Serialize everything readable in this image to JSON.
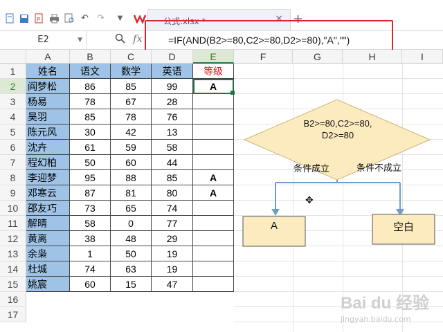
{
  "toolbar": {
    "tab_title": "公式.xlsx *",
    "tab_close": "×",
    "tab_add": "+",
    "icons": [
      "new-file-icon",
      "save-icon",
      "export-pdf-icon",
      "print-icon",
      "print-preview-icon",
      "undo-icon",
      "redo-icon",
      "dropdown-icon",
      "wps-logo-icon"
    ]
  },
  "formula_bar": {
    "cell_ref": "E2",
    "formula": "=IF(AND(B2>=80,C2>=80,D2>=80),\"A\",\"\")",
    "fx": "fx"
  },
  "columns": [
    "A",
    "B",
    "C",
    "D",
    "E",
    "F",
    "G",
    "H",
    "I"
  ],
  "rows": [
    "1",
    "2",
    "3",
    "4",
    "5",
    "6",
    "7",
    "8",
    "9",
    "10",
    "11",
    "12",
    "13",
    "14",
    "15",
    "16",
    "17"
  ],
  "table": {
    "headers": [
      "姓名",
      "语文",
      "数学",
      "英语",
      "等级"
    ],
    "data": [
      [
        "阎梦松",
        "86",
        "85",
        "99",
        "A"
      ],
      [
        "杨易",
        "78",
        "67",
        "28",
        ""
      ],
      [
        "吴羽",
        "85",
        "78",
        "76",
        ""
      ],
      [
        "陈元风",
        "30",
        "42",
        "13",
        ""
      ],
      [
        "沈卉",
        "61",
        "59",
        "58",
        ""
      ],
      [
        "程幻柏",
        "50",
        "60",
        "44",
        ""
      ],
      [
        "李迎梦",
        "95",
        "88",
        "85",
        "A"
      ],
      [
        "邓寒云",
        "87",
        "81",
        "80",
        "A"
      ],
      [
        "邵友巧",
        "73",
        "65",
        "74",
        ""
      ],
      [
        "解晴",
        "58",
        "0",
        "77",
        ""
      ],
      [
        "黄离",
        "38",
        "48",
        "29",
        ""
      ],
      [
        "余枭",
        "1",
        "50",
        "19",
        ""
      ],
      [
        "杜城",
        "74",
        "63",
        "19",
        ""
      ],
      [
        "姚宸",
        "60",
        "15",
        "47",
        ""
      ]
    ]
  },
  "diagram": {
    "condition": "B2>=80,C2>=80,\nD2>=80",
    "condition_line1": "B2>=80,C2>=80,",
    "condition_line2": "D2>=80",
    "true_label": "条件成立",
    "false_label": "条件不成立",
    "true_result": "A",
    "false_result": "空白"
  },
  "colors": {
    "header_fill": "#9ec3e6",
    "grade_header_text": "#e0191e",
    "diagram_fill": "#fdebc0",
    "highlight_border": "#d9262d",
    "arrow": "#6d9ec9"
  },
  "watermark": {
    "logo": "Bai du 经验",
    "url": "jingyan.baidu.com"
  }
}
